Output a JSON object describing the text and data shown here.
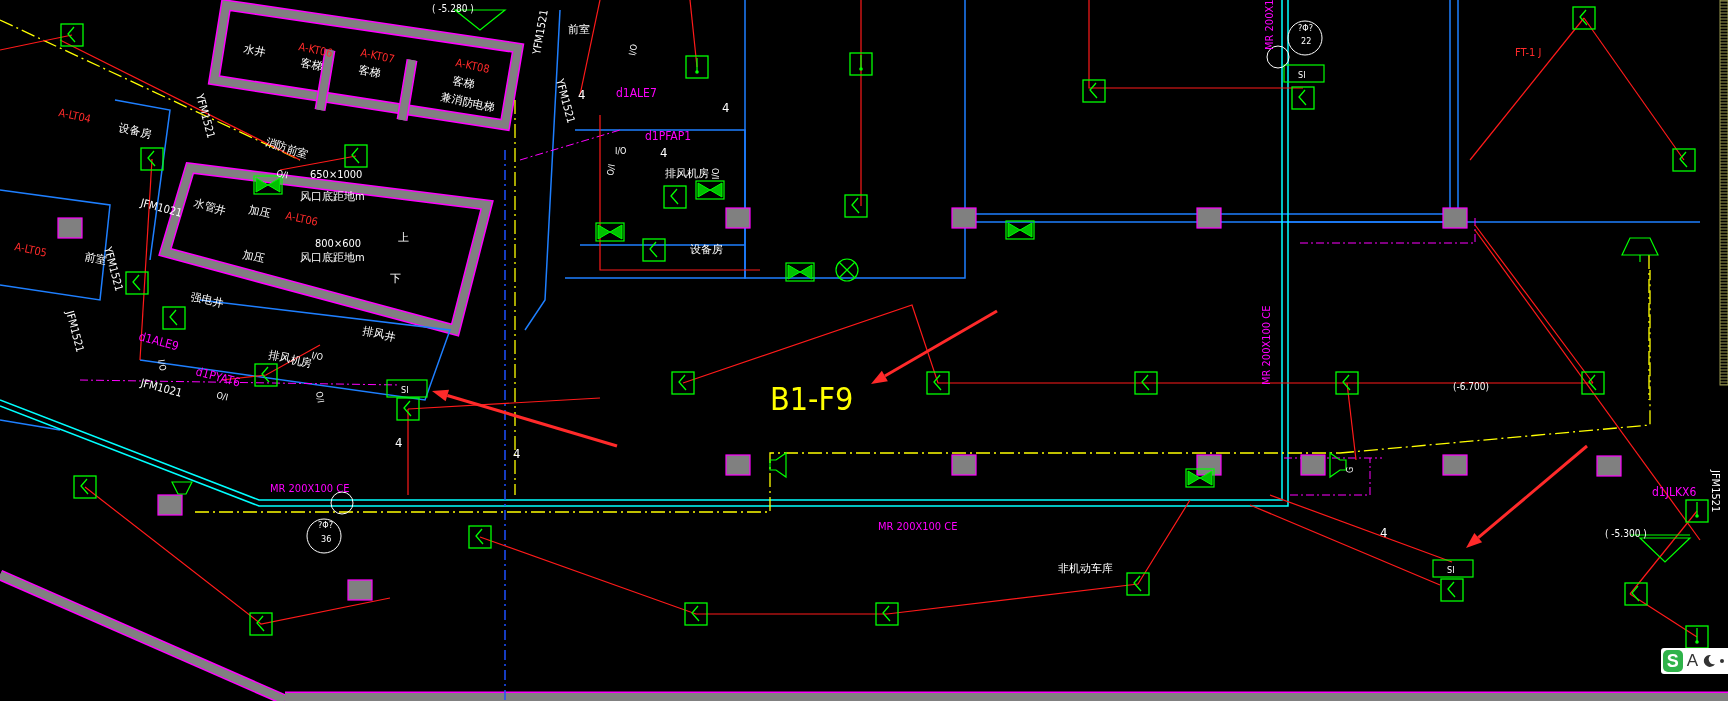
{
  "drawing": {
    "labels": [
      {
        "text": "( -5.280 )",
        "kind": "elevation"
      },
      {
        "text": "水井",
        "kind": "room"
      },
      {
        "text": "A-KT06",
        "kind": "tag"
      },
      {
        "text": "客梯",
        "kind": "room"
      },
      {
        "text": "A-KT07",
        "kind": "tag"
      },
      {
        "text": "客梯",
        "kind": "room"
      },
      {
        "text": "A-KT08",
        "kind": "tag"
      },
      {
        "text": "客梯",
        "kind": "room"
      },
      {
        "text": "兼消防电梯",
        "kind": "room"
      },
      {
        "text": "YFM1521",
        "kind": "room"
      },
      {
        "text": "YFM1521",
        "kind": "room"
      },
      {
        "text": "A-LT04",
        "kind": "tag"
      },
      {
        "text": "设备房",
        "kind": "room"
      },
      {
        "text": "YFM1521",
        "kind": "room"
      },
      {
        "text": "消防前室",
        "kind": "room"
      },
      {
        "text": "O/I",
        "kind": "symbol"
      },
      {
        "text": "650×1000",
        "kind": "room"
      },
      {
        "text": "风口底距地m",
        "kind": "room"
      },
      {
        "text": "JFM1021",
        "kind": "room"
      },
      {
        "text": "水管井",
        "kind": "room"
      },
      {
        "text": "加压",
        "kind": "room"
      },
      {
        "text": "A-LT06",
        "kind": "tag"
      },
      {
        "text": "加压",
        "kind": "room"
      },
      {
        "text": "800×600",
        "kind": "room"
      },
      {
        "text": "上",
        "kind": "room"
      },
      {
        "text": "风口底距地m",
        "kind": "room"
      },
      {
        "text": "A-LT05",
        "kind": "tag"
      },
      {
        "text": "下",
        "kind": "room"
      },
      {
        "text": "前室",
        "kind": "room"
      },
      {
        "text": "YFM1521",
        "kind": "room"
      },
      {
        "text": "强电井",
        "kind": "room"
      },
      {
        "text": "JFM1521",
        "kind": "room"
      },
      {
        "text": "d1ALE9",
        "kind": "circuit"
      },
      {
        "text": "排风井",
        "kind": "room"
      },
      {
        "text": "排风机房",
        "kind": "room"
      },
      {
        "text": "I/O",
        "kind": "symbol"
      },
      {
        "text": "I/O",
        "kind": "symbol"
      },
      {
        "text": "d1PYAT6",
        "kind": "circuit"
      },
      {
        "text": "JFM1021",
        "kind": "room"
      },
      {
        "text": "O/I",
        "kind": "symbol"
      },
      {
        "text": "O/I",
        "kind": "symbol"
      },
      {
        "text": "SI",
        "kind": "symbol"
      },
      {
        "text": "4",
        "kind": "count"
      },
      {
        "text": "4",
        "kind": "count"
      },
      {
        "text": "MR 200X100 CE",
        "kind": "duct"
      },
      {
        "text": "?Φ?",
        "kind": "symbol"
      },
      {
        "text": "36",
        "kind": "symbol"
      },
      {
        "text": "前室",
        "kind": "room"
      },
      {
        "text": "I/O",
        "kind": "symbol"
      },
      {
        "text": "4",
        "kind": "count"
      },
      {
        "text": "d1ALE7",
        "kind": "circuit"
      },
      {
        "text": "4",
        "kind": "count"
      },
      {
        "text": "d1PFAP1",
        "kind": "circuit"
      },
      {
        "text": "I/O",
        "kind": "symbol"
      },
      {
        "text": "4",
        "kind": "count"
      },
      {
        "text": "O/I",
        "kind": "symbol"
      },
      {
        "text": "排风机房",
        "kind": "room"
      },
      {
        "text": "O/I",
        "kind": "symbol"
      },
      {
        "text": "设备房",
        "kind": "room"
      },
      {
        "text": "B1-F9",
        "kind": "title"
      },
      {
        "text": "MR 200X100 CE",
        "kind": "duct"
      },
      {
        "text": "非机动车库",
        "kind": "room"
      },
      {
        "text": "MR 200X1",
        "kind": "duct"
      },
      {
        "text": "?Φ?",
        "kind": "symbol"
      },
      {
        "text": "22",
        "kind": "symbol"
      },
      {
        "text": "SI",
        "kind": "symbol"
      },
      {
        "text": "FT-1 J",
        "kind": "tag"
      },
      {
        "text": "MR 200X100 CE",
        "kind": "duct"
      },
      {
        "text": "(-6.700)",
        "kind": "elevation"
      },
      {
        "text": "G",
        "kind": "symbol"
      },
      {
        "text": "4",
        "kind": "count"
      },
      {
        "text": "SI",
        "kind": "symbol"
      },
      {
        "text": "( -5.300 )",
        "kind": "elevation"
      },
      {
        "text": "d1JLKX6",
        "kind": "circuit"
      },
      {
        "text": "JFM1521",
        "kind": "room"
      }
    ]
  },
  "ime_toolbar": {
    "logo": "S",
    "mode": "A"
  }
}
